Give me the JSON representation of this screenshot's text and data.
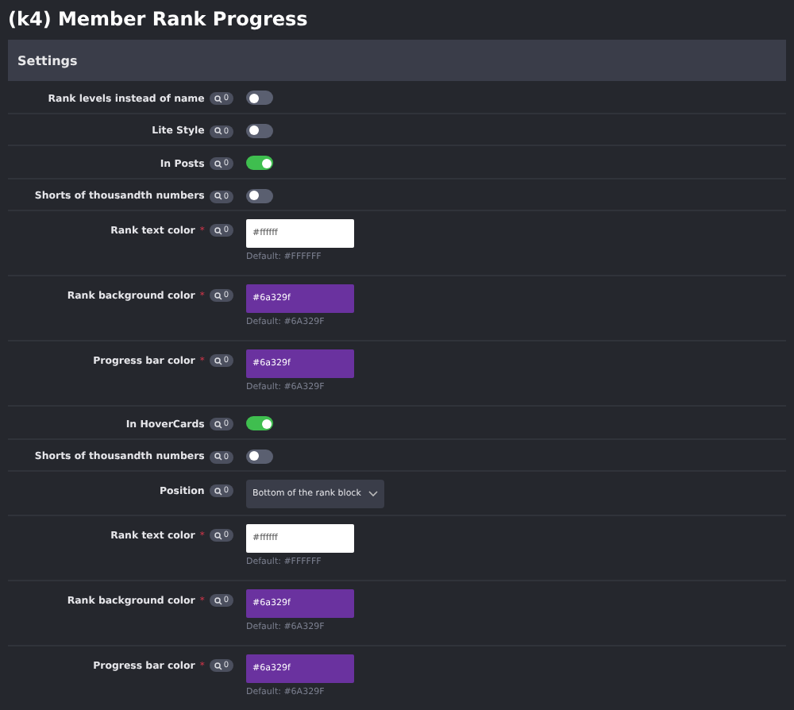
{
  "window": {
    "title": "(k4) Member Rank Progress"
  },
  "section": {
    "title": "Settings"
  },
  "rows": [
    {
      "kind": "toggle",
      "label": "Rank levels instead of name",
      "badge": "0",
      "on": false
    },
    {
      "kind": "toggle",
      "label": "Lite Style",
      "badge": "0",
      "on": false
    },
    {
      "kind": "toggle",
      "label": "In Posts",
      "badge": "0",
      "on": true
    },
    {
      "kind": "toggle",
      "label": "Shorts of thousandth numbers",
      "badge": "0",
      "on": false
    },
    {
      "kind": "color",
      "label": "Rank text color",
      "required_mark": "*",
      "badge": "0",
      "value": "#ffffff",
      "color": "#ffffff",
      "hint": "Default: #FFFFFF"
    },
    {
      "kind": "color",
      "label": "Rank background color",
      "required_mark": "*",
      "badge": "0",
      "value": "#6a329f",
      "color": "#6a329f",
      "hint": "Default: #6A329F"
    },
    {
      "kind": "color",
      "label": "Progress bar color",
      "required_mark": "*",
      "badge": "0",
      "value": "#6a329f",
      "color": "#6a329f",
      "hint": "Default: #6A329F"
    },
    {
      "kind": "toggle",
      "label": "In HoverCards",
      "badge": "0",
      "on": true
    },
    {
      "kind": "toggle",
      "label": "Shorts of thousandth numbers",
      "badge": "0",
      "on": false
    },
    {
      "kind": "select",
      "label": "Position",
      "badge": "0",
      "value": "Bottom of the rank block"
    },
    {
      "kind": "color",
      "label": "Rank text color",
      "required_mark": "*",
      "badge": "0",
      "value": "#ffffff",
      "color": "#ffffff",
      "hint": "Default: #FFFFFF"
    },
    {
      "kind": "color",
      "label": "Rank background color",
      "required_mark": "*",
      "badge": "0",
      "value": "#6a329f",
      "color": "#6a329f",
      "hint": "Default: #6A329F"
    },
    {
      "kind": "color",
      "label": "Progress bar color",
      "required_mark": "*",
      "badge": "0",
      "value": "#6a329f",
      "color": "#6a329f",
      "hint": "Default: #6A329F"
    }
  ]
}
